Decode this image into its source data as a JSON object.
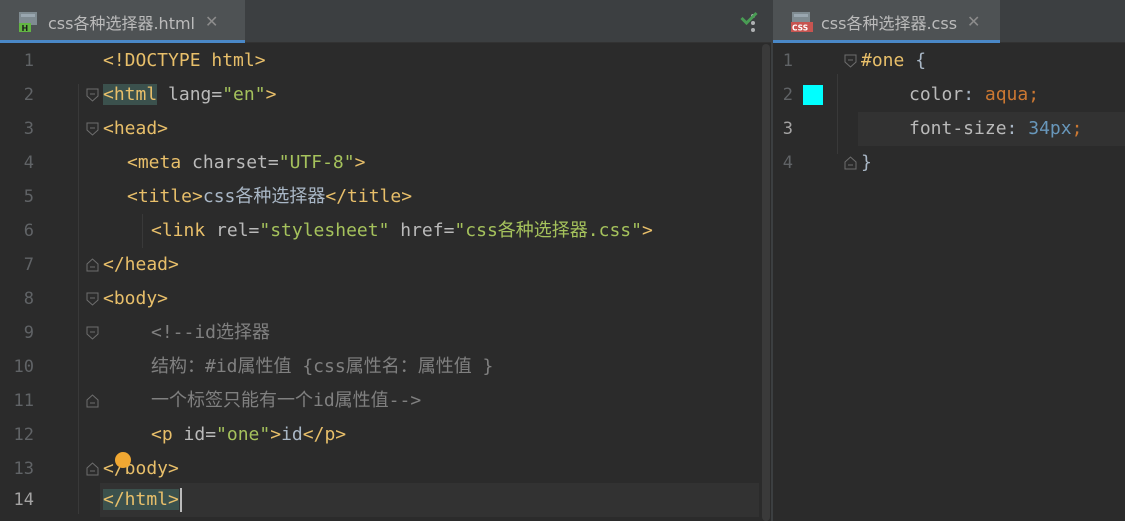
{
  "left_editor": {
    "tab": {
      "title": "css各种选择器.html",
      "close": "✕"
    },
    "lines": [
      {
        "num": "1"
      },
      {
        "num": "2"
      },
      {
        "num": "3"
      },
      {
        "num": "4"
      },
      {
        "num": "5"
      },
      {
        "num": "6"
      },
      {
        "num": "7"
      },
      {
        "num": "8"
      },
      {
        "num": "9"
      },
      {
        "num": "10"
      },
      {
        "num": "11"
      },
      {
        "num": "12"
      },
      {
        "num": "13"
      },
      {
        "num": "14"
      }
    ],
    "code": {
      "l1": "<!DOCTYPE html>",
      "l2_open": "<html",
      "l2_attr": " lang=",
      "l2_val": "\"en\"",
      "l2_close": ">",
      "l3": "<head>",
      "l4_open": "<meta",
      "l4_attr": " charset=",
      "l4_val": "\"UTF-8\"",
      "l4_close": ">",
      "l5_open": "<title>",
      "l5_text": "css各种选择器",
      "l5_close": "</title>",
      "l6_open": "<link",
      "l6_attr1": " rel=",
      "l6_val1": "\"stylesheet\"",
      "l6_attr2": " href=",
      "l6_val2": "\"css各种选择器.css\"",
      "l6_close": ">",
      "l7": "</head>",
      "l8": "<body>",
      "l9": "<!--id选择器",
      "l10": "结构：#id属性值 {css属性名：属性值 }",
      "l11": "一个标签只能有一个id属性值-->",
      "l12_open": "<p",
      "l12_attr": " id=",
      "l12_val": "\"one\"",
      "l12_gt": ">",
      "l12_text": "id",
      "l12_close": "</p>",
      "l13": "</body>",
      "l14": "</html>"
    },
    "status_icon": "check-icon"
  },
  "right_editor": {
    "tab": {
      "title": "css各种选择器.css",
      "close": "✕"
    },
    "lines": [
      {
        "num": "1"
      },
      {
        "num": "2"
      },
      {
        "num": "3"
      },
      {
        "num": "4"
      }
    ],
    "code": {
      "l1_sel": "#one",
      "l1_brace": " {",
      "l2_prop": "color",
      "l2_colon": ": ",
      "l2_val": "aqua",
      "l2_semi": ";",
      "l3_prop": "font-size",
      "l3_colon": ": ",
      "l3_val": "34px",
      "l3_semi": ";",
      "l4": "}"
    },
    "swatch_color": "#00ffff"
  },
  "colors": {
    "background": "#2b2b2b",
    "tag": "#e8bf6a",
    "string": "#a5c25c",
    "comment": "#808080",
    "accent": "#4a88c7"
  }
}
